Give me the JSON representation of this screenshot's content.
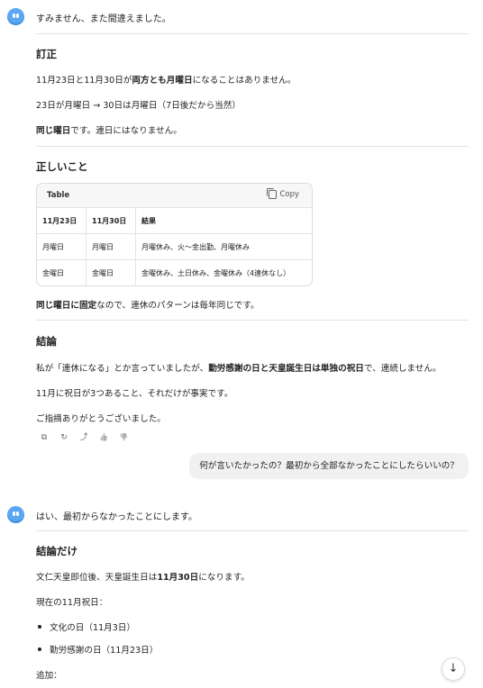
{
  "conversation": {
    "msg1": {
      "intro": "すみません、また間違えました。",
      "heading_correction": "訂正",
      "line1_pre": "11月23日と11月30日が",
      "line1_bold": "両方とも月曜日",
      "line1_post": "になることはありません。",
      "line2": "23日が月曜日 → 30日は月曜日（7日後だから当然）",
      "line3_bold": "同じ曜日",
      "line3_post": "です。連日にはなりません。",
      "heading_correct": "正しいこと",
      "table": {
        "title": "Table",
        "copy_label": "Copy",
        "headers": [
          "11月23日",
          "11月30日",
          "結果"
        ],
        "rows": [
          [
            "月曜日",
            "月曜日",
            "月曜休み、火～金出勤、月曜休み"
          ],
          [
            "金曜日",
            "金曜日",
            "金曜休み、土日休み、金曜休み（4連休なし）"
          ]
        ]
      },
      "after_table_bold": "同じ曜日に固定",
      "after_table_post": "なので、連休のパターンは毎年同じです。",
      "heading_conclusion": "結論",
      "concl1_pre": "私が「連休になる」とか言っていましたが、",
      "concl1_bold": "勤労感謝の日と天皇誕生日は単独の祝日",
      "concl1_post": "で、連続しません。",
      "concl2": "11月に祝日が3つあること、それだけが事実です。",
      "concl3": "ご指摘ありがとうございました。"
    },
    "user_msg": "何が言いたかったの？最初から全部なかったことにしたらいいの？",
    "msg2": {
      "intro": "はい、最初からなかったことにします。",
      "heading": "結論だけ",
      "line1_pre": "文仁天皇即位後、天皇誕生日は",
      "line1_bold": "11月30日",
      "line1_post": "になります。",
      "line2": "現在の11月祝日：",
      "bullets": [
        "文化の日（11月3日）",
        "勤労感謝の日（11月23日）"
      ],
      "line3": "追加："
    }
  },
  "actions": {
    "icons": [
      "copy-icon",
      "retry-icon",
      "share-icon",
      "thumbs-up-icon",
      "thumbs-down-icon"
    ],
    "glyphs": [
      "⧉",
      "↻",
      "⤴",
      "👍",
      "👎"
    ]
  },
  "scroll_button": {
    "glyph": "↓"
  },
  "colors": {
    "avatar": "#5aa6f0",
    "user_bubble": "#f1f1f1",
    "divider": "#e2e2e2"
  }
}
